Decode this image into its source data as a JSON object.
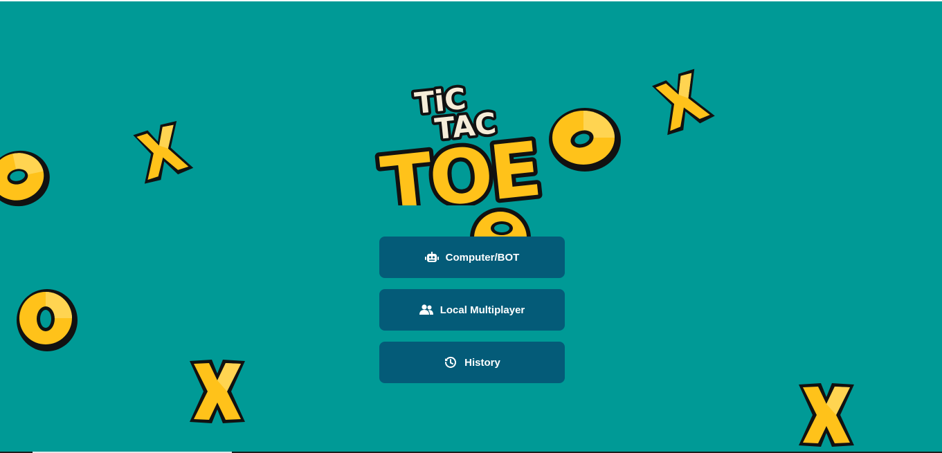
{
  "logo": {
    "line1": "TiC",
    "line2": "TAC",
    "line3": "TOE"
  },
  "menu": {
    "items": [
      {
        "label": "Computer/BOT",
        "icon": "robot-icon"
      },
      {
        "label": "Local Multiplayer",
        "icon": "users-icon"
      },
      {
        "label": "History",
        "icon": "history-icon"
      }
    ]
  },
  "colors": {
    "background": "#009a96",
    "button": "#045b78",
    "button_text": "#ffffff",
    "piece_yellow": "#ffc21a",
    "piece_outline": "#111111"
  }
}
